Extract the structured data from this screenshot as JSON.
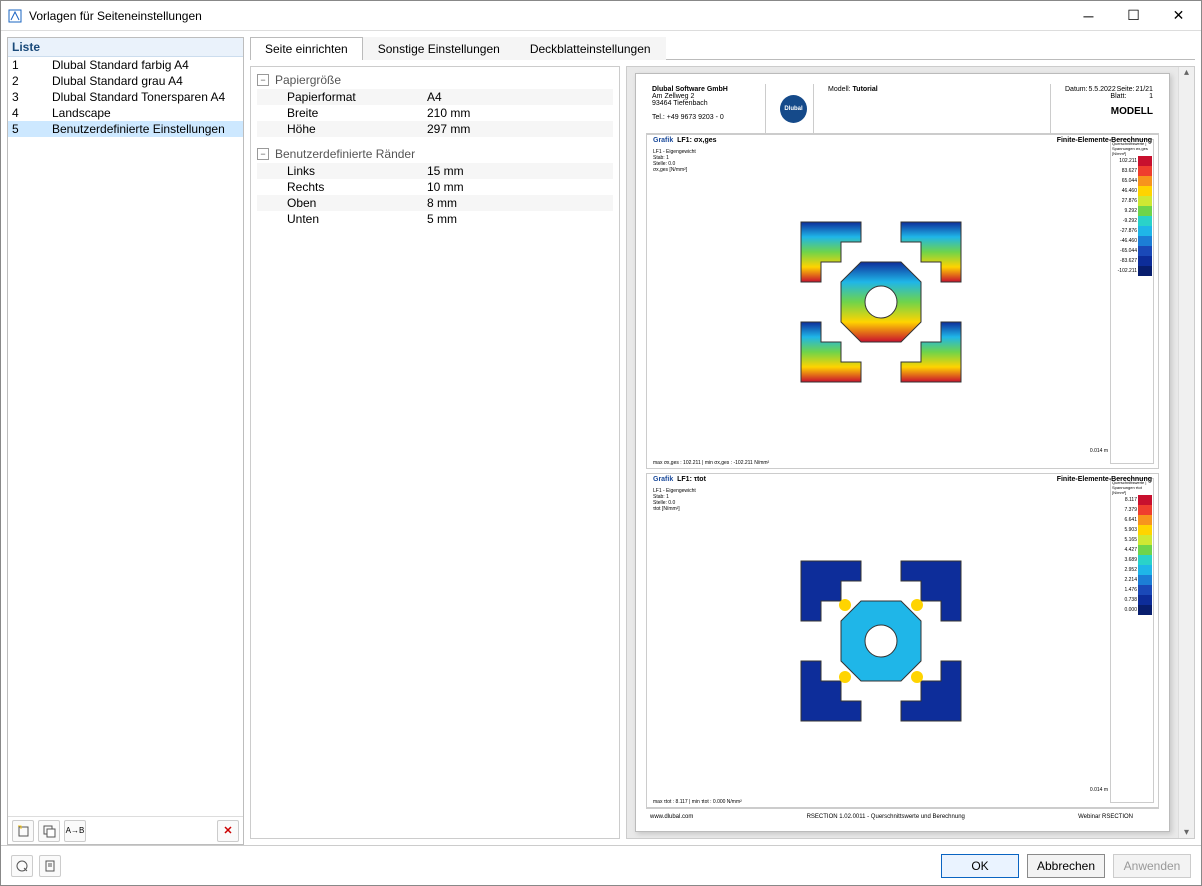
{
  "window": {
    "title": "Vorlagen für Seiteneinstellungen"
  },
  "list": {
    "header": "Liste",
    "items": [
      {
        "n": "1",
        "name": "Dlubal Standard farbig A4"
      },
      {
        "n": "2",
        "name": "Dlubal Standard grau A4"
      },
      {
        "n": "3",
        "name": "Dlubal Standard Tonersparen A4"
      },
      {
        "n": "4",
        "name": "Landscape"
      },
      {
        "n": "5",
        "name": "Benutzerdefinierte Einstellungen"
      }
    ],
    "selected": 4
  },
  "tabs": {
    "items": [
      "Seite einrichten",
      "Sonstige Einstellungen",
      "Deckblatteinstellungen"
    ],
    "active": 0
  },
  "settings": {
    "group1": "Papiergröße",
    "rows1": [
      {
        "k": "Papierformat",
        "v": "A4"
      },
      {
        "k": "Breite",
        "v": "210 mm"
      },
      {
        "k": "Höhe",
        "v": "297 mm"
      }
    ],
    "group2": "Benutzerdefinierte Ränder",
    "rows2": [
      {
        "k": "Links",
        "v": "15 mm"
      },
      {
        "k": "Rechts",
        "v": "10 mm"
      },
      {
        "k": "Oben",
        "v": "8 mm"
      },
      {
        "k": "Unten",
        "v": "5 mm"
      }
    ]
  },
  "preview": {
    "company": "Dlubal Software GmbH",
    "addr1": "Am Zellweg 2",
    "addr2": "93464 Tiefenbach",
    "tel": "Tel.: +49 9673 9203 - 0",
    "logoText": "Dlubal",
    "modellLabel": "Modell:",
    "modellValue": "Tutorial",
    "datumLabel": "Datum:",
    "datumValue": "5.5.2022",
    "seiteLabel": "Seite:",
    "seiteValue": "21/21",
    "blattLabel": "Blatt:",
    "blattValue": "1",
    "modellBig": "MODELL",
    "grafikLabel": "Grafik",
    "fig1Title": "LF1: σx,ges",
    "fig1Right": "Finite-Elemente-Berechnung",
    "fig1InfoA": "LF1 - Eigengewicht",
    "fig1InfoB": "Stab: 1",
    "fig1InfoC": "Stelle: 0.0",
    "fig1InfoD": "σx,ges [N/mm²]",
    "fig1Scale": "0.014 m",
    "fig1Foot": "max σx,ges : 102.211 | min σx,ges : -102.211 N/mm²",
    "fig2Title": "LF1: τtot",
    "fig2Right": "Finite-Elemente-Berechnung",
    "fig2InfoA": "LF1 - Eigengewicht",
    "fig2InfoB": "Stab: 1",
    "fig2InfoC": "Stelle: 0.0",
    "fig2InfoD": "τtot [N/mm²]",
    "fig2Scale": "0.014 m",
    "fig2Foot": "max τtot : 8.117 | min τtot : 0.000 N/mm²",
    "legend1Head": "Querschnittswerte | Spannungen σx,ges [N/mm²]",
    "legend1": [
      {
        "v": "102.211",
        "c": "#c8102e"
      },
      {
        "v": "83.627",
        "c": "#ef3e2e"
      },
      {
        "v": "65.044",
        "c": "#f7941d"
      },
      {
        "v": "46.460",
        "c": "#ffd400"
      },
      {
        "v": "27.876",
        "c": "#cfe833"
      },
      {
        "v": "9.292",
        "c": "#6fd44b"
      },
      {
        "v": "-9.292",
        "c": "#2ad2c9"
      },
      {
        "v": "-27.876",
        "c": "#1fb6e8"
      },
      {
        "v": "-46.460",
        "c": "#1c7ed6"
      },
      {
        "v": "-65.044",
        "c": "#1a49b8"
      },
      {
        "v": "-83.627",
        "c": "#0d2d9a"
      },
      {
        "v": "-102.211",
        "c": "#081e6e"
      }
    ],
    "legend2Head": "Querschnittswerte | Spannungen τtot [N/mm²]",
    "legend2": [
      {
        "v": "8.117",
        "c": "#c8102e"
      },
      {
        "v": "7.379",
        "c": "#ef3e2e"
      },
      {
        "v": "6.641",
        "c": "#f7941d"
      },
      {
        "v": "5.903",
        "c": "#ffd400"
      },
      {
        "v": "5.165",
        "c": "#cfe833"
      },
      {
        "v": "4.427",
        "c": "#6fd44b"
      },
      {
        "v": "3.689",
        "c": "#2ad2c9"
      },
      {
        "v": "2.952",
        "c": "#1fb6e8"
      },
      {
        "v": "2.214",
        "c": "#1c7ed6"
      },
      {
        "v": "1.476",
        "c": "#1a49b8"
      },
      {
        "v": "0.738",
        "c": "#0d2d9a"
      },
      {
        "v": "0.000",
        "c": "#081e6e"
      }
    ],
    "footerLeft": "www.dlubal.com",
    "footerMid": "RSECTION 1.02.0011 - Querschnittswerte und Berechnung",
    "footerRight": "Webinar RSECTION"
  },
  "buttons": {
    "ok": "OK",
    "cancel": "Abbrechen",
    "apply": "Anwenden"
  }
}
